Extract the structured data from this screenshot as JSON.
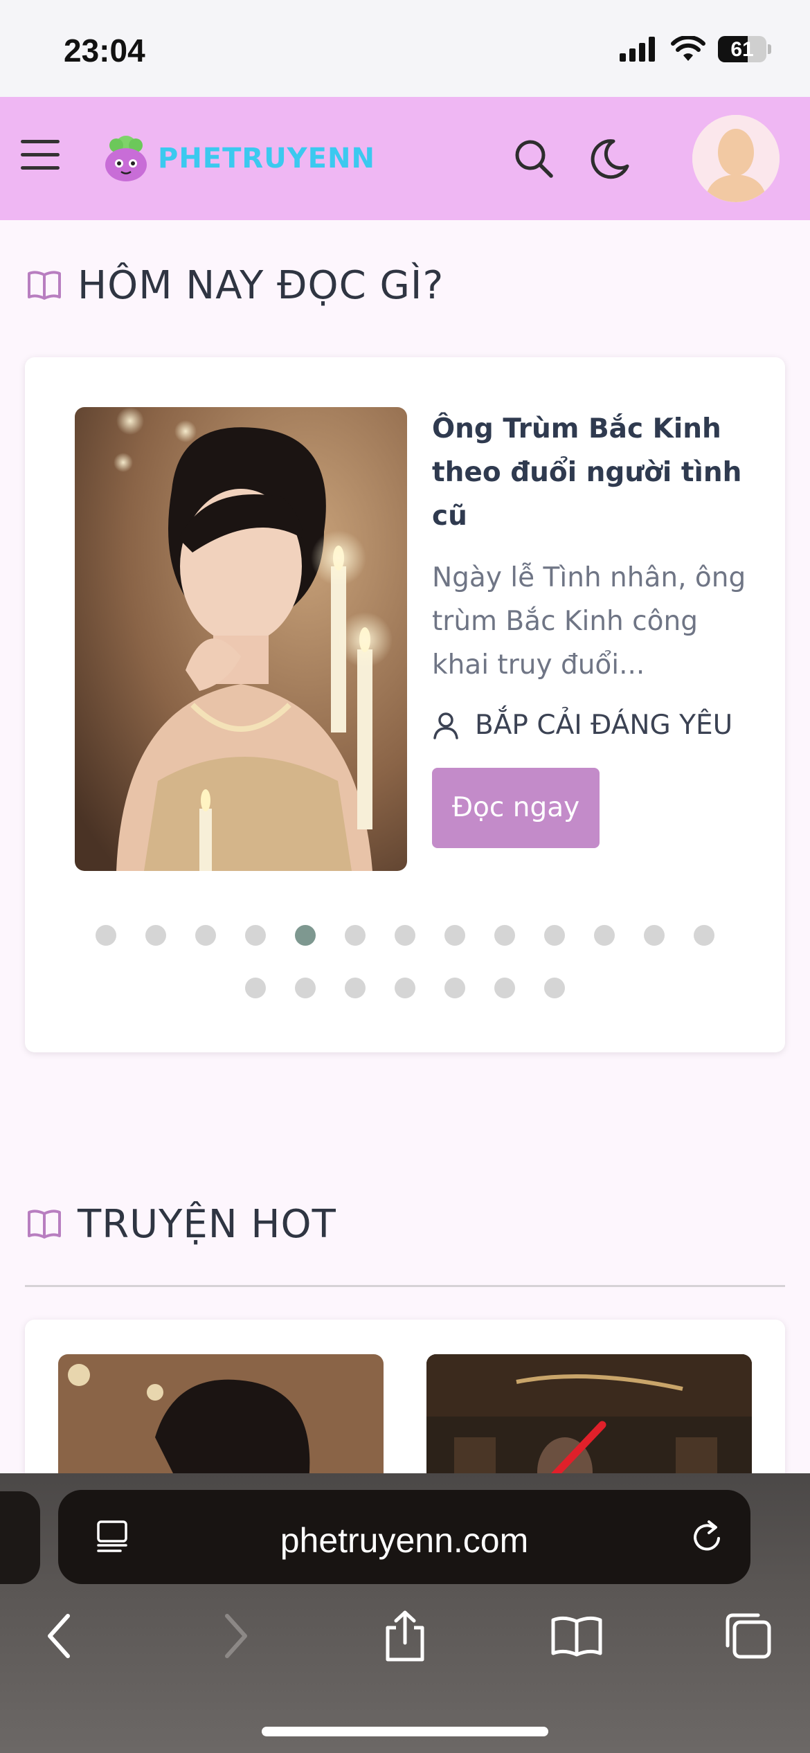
{
  "status_bar": {
    "time": "23:04",
    "battery": "61",
    "battery_fraction": 0.61
  },
  "header": {
    "logo_text": "PHETRUYENN",
    "brand_color": "#efb7f3",
    "logo_color": "#3bc9ef"
  },
  "featured": {
    "heading": "HÔM NAY ĐỌC GÌ?",
    "story": {
      "title": "Ông Trùm Bắc Kinh theo đuổi người tình cũ",
      "description": "Ngày lễ Tình nhân, ông trùm Bắc Kinh công khai truy đuổi...",
      "author": "BẮP CẢI ĐÁNG YÊU",
      "read_button": "Đọc ngay"
    },
    "slider": {
      "total": 20,
      "active_index": 4
    },
    "accent_color": "#c38bc9"
  },
  "hot": {
    "heading": "TRUYỆN HOT"
  },
  "browser": {
    "url": "phetruyenn.com"
  },
  "icons": {
    "menu": "hamburger-icon",
    "search": "search-icon",
    "theme": "moon-icon",
    "book": "book-icon",
    "author": "user-icon",
    "back": "chevron-left-icon",
    "forward": "chevron-right-icon",
    "share": "share-icon",
    "bookmarks": "book-open-icon",
    "tabs": "tabs-icon",
    "reader": "reader-icon",
    "reload": "reload-icon"
  }
}
